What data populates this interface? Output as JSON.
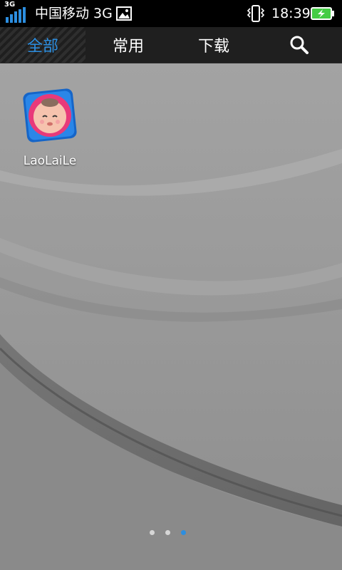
{
  "statusbar": {
    "network_type": "3G",
    "carrier": "中国移动 3G",
    "time": "18:39"
  },
  "tabs": [
    {
      "label": "全部",
      "active": true
    },
    {
      "label": "常用",
      "active": false
    },
    {
      "label": "下载",
      "active": false
    }
  ],
  "search_icon": "search-icon",
  "apps": [
    {
      "label": "LaoLaiLe",
      "icon": "laolaile-app-icon"
    }
  ],
  "pager": {
    "pages": 3,
    "current": 3
  },
  "colors": {
    "accent": "#2c8ee0",
    "statusbar": "#000000",
    "tabbar": "#1f1f1f",
    "battery": "#44cc44"
  }
}
